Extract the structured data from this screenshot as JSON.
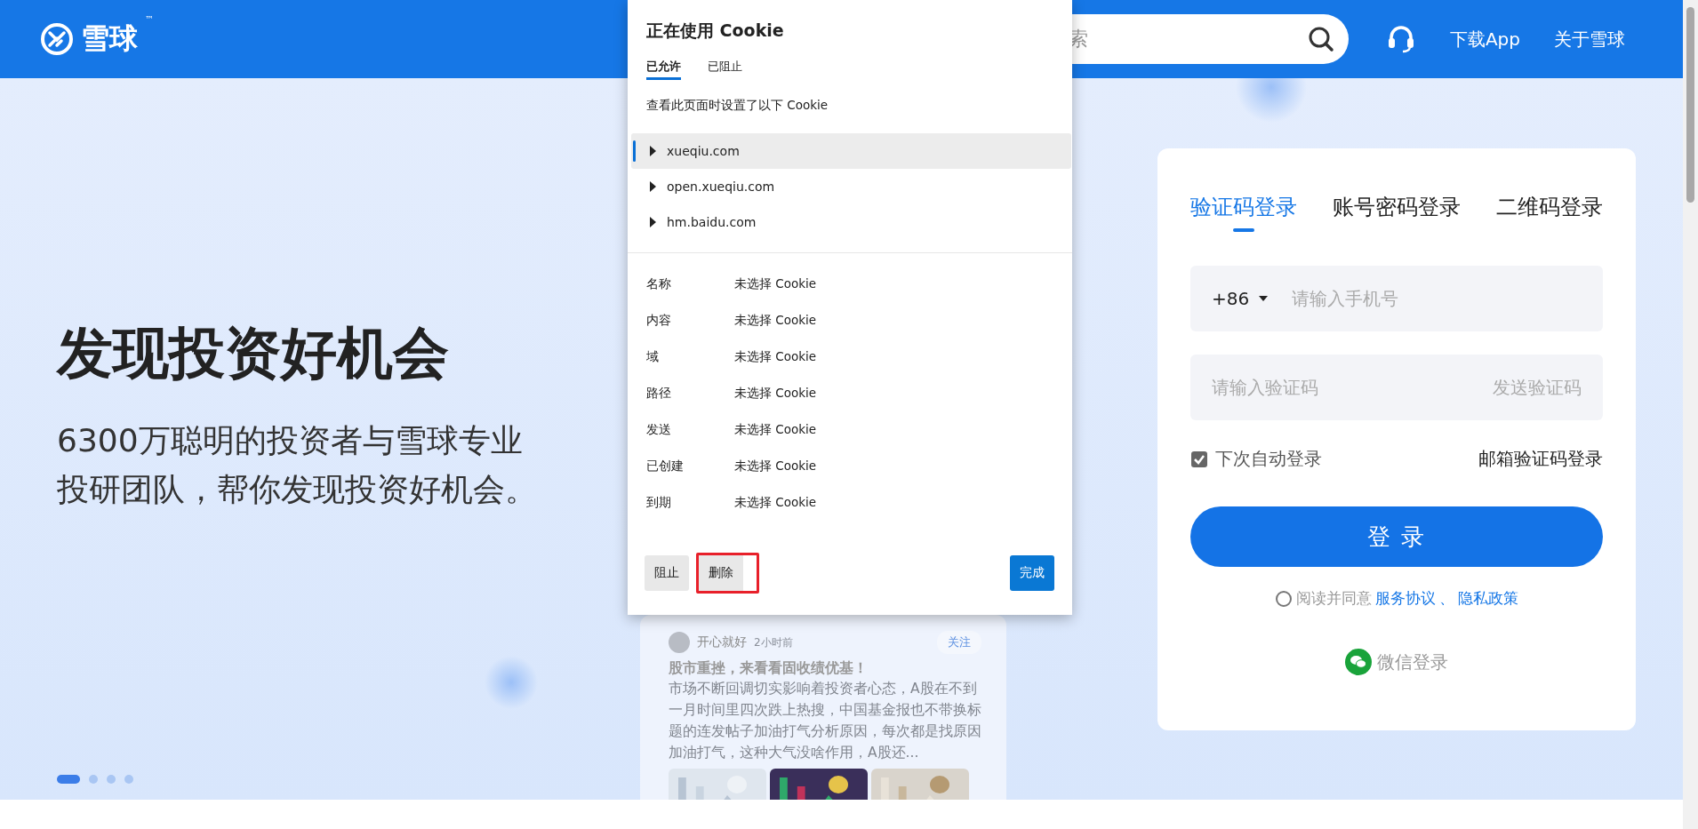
{
  "header": {
    "logo": "雪球",
    "logo_trademark": "™",
    "search": {
      "placeholder": "索"
    },
    "links": [
      "下载App",
      "关于雪球"
    ]
  },
  "hero": {
    "title": "发现投资好机会",
    "subtitle_lines": [
      "6300万聪明的投资者与雪球专业",
      "投研团队，帮你发现投资好机会。"
    ],
    "carousel_dots": [
      {
        "selected": true
      },
      {
        "selected": false
      },
      {
        "selected": false
      },
      {
        "selected": false
      }
    ]
  },
  "feed_card": {
    "author": "开心就好",
    "time": "2小时前",
    "follow": "关注",
    "title": "股市重挫，来看看固收绩优基！",
    "body": "市场不断回调切实影响着投资者心态，A股在不到一月时间里四次跌上热搜，中国基金报也不带换标题的连发帖子加油打气分析原因，每次都是找原因加油打气，这种大气没啥作用，A股还..."
  },
  "login": {
    "tabs": [
      {
        "label": "验证码登录",
        "selected": true
      },
      {
        "label": "账号密码登录",
        "selected": false
      },
      {
        "label": "二维码登录",
        "selected": false
      }
    ],
    "phone": {
      "country_code": "+86",
      "placeholder": "请输入手机号"
    },
    "code": {
      "placeholder": "请输入验证码",
      "send": "发送验证码"
    },
    "remember": {
      "label": "下次自动登录",
      "checked": true
    },
    "email_login": "邮箱验证码登录",
    "submit": "登 录",
    "agreement": {
      "checked": false,
      "text": "阅读并同意",
      "links": [
        "服务协议",
        "隐私政策"
      ],
      "separator": "、"
    },
    "wechat": "微信登录"
  },
  "cookie_dialog": {
    "title": "正在使用 Cookie",
    "tabs": [
      {
        "label": "已允许",
        "selected": true
      },
      {
        "label": "已阻止",
        "selected": false
      }
    ],
    "description": "查看此页面时设置了以下 Cookie",
    "sites": [
      {
        "domain": "xueqiu.com",
        "selected": true,
        "expanded": false
      },
      {
        "domain": "open.xueqiu.com",
        "selected": false,
        "expanded": false
      },
      {
        "domain": "hm.baidu.com",
        "selected": false,
        "expanded": false
      }
    ],
    "details": [
      {
        "label": "名称",
        "value": "未选择 Cookie"
      },
      {
        "label": "内容",
        "value": "未选择 Cookie"
      },
      {
        "label": "域",
        "value": "未选择 Cookie"
      },
      {
        "label": "路径",
        "value": "未选择 Cookie"
      },
      {
        "label": "发送",
        "value": "未选择 Cookie"
      },
      {
        "label": "已创建",
        "value": "未选择 Cookie"
      },
      {
        "label": "到期",
        "value": "未选择 Cookie"
      }
    ],
    "buttons": [
      {
        "label": "阻止",
        "kind": "secondary",
        "highlighted": false
      },
      {
        "label": "删除",
        "kind": "secondary",
        "highlighted": true
      },
      {
        "label": "完成",
        "kind": "primary",
        "highlighted": false
      }
    ]
  }
}
